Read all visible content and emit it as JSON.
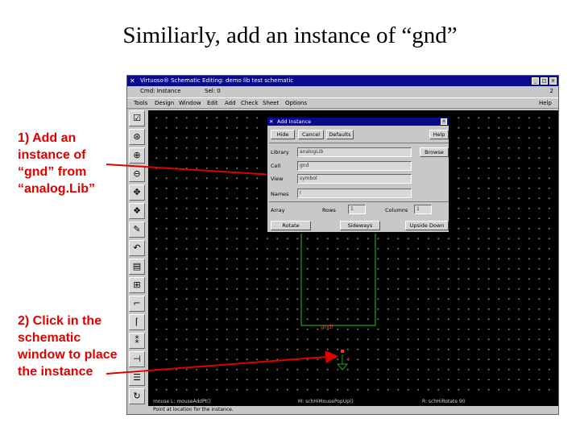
{
  "slide": {
    "title": "Similiarly, add an instance of “gnd”",
    "annotation1": "1) Add an instance of “gnd” from “analog.Lib”",
    "annotation2": "2) Click in the schematic window to place the instance"
  },
  "virtuoso": {
    "title": "Virtuoso® Schematic Editing: demo lib test schematic",
    "command": "Cmd: Instance",
    "selected": "Sel: 0",
    "status_right": "2",
    "menu": [
      "Tools",
      "Design",
      "Window",
      "Edit",
      "Add",
      "Check",
      "Sheet",
      "Options"
    ],
    "menu_help": "Help",
    "footer": {
      "mouse_l": "mouse L: mouseAddPt()",
      "mouse_m": "M: schHiMousePopUp()",
      "mouse_r": "R: schHiRotate 90",
      "hint": "Point at location for the instance."
    },
    "net_label": "gnd!"
  },
  "dialog": {
    "title": "Add Instance",
    "buttons": {
      "hide": "Hide",
      "cancel": "Cancel",
      "defaults": "Defaults",
      "help": "Help"
    },
    "library_label": "Library",
    "library_value": "analogLib",
    "browse": "Browse",
    "cell_label": "Cell",
    "cell_value": "gnd",
    "view_label": "View",
    "view_value": "symbol",
    "names_label": "Names",
    "names_value": "I",
    "array_label": "Array",
    "rows_label": "Rows",
    "rows_value": "1",
    "columns_label": "Columns",
    "columns_value": "1",
    "rotate": "Rotate",
    "sideways": "Sideways",
    "upside_down": "Upside Down"
  },
  "colors": {
    "annotation": "#e00000",
    "titlebar": "#0a0a8c",
    "canvas": "#000000",
    "wire": "#1aa51a",
    "net_label": "#ff3030",
    "ground_symbol": "#1aa51a"
  }
}
